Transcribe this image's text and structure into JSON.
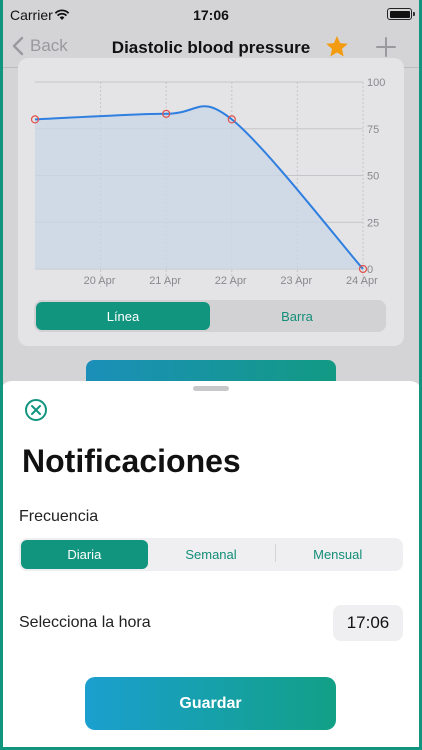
{
  "status_bar": {
    "carrier": "Carrier",
    "time": "17:06"
  },
  "nav": {
    "back_label": "Back",
    "title": "Diastolic blood pressure"
  },
  "chart_data": {
    "type": "line",
    "x": [
      "19 Apr",
      "21 Apr",
      "22 Apr",
      "24 Apr"
    ],
    "points": [
      {
        "x": 19.0,
        "y": 80
      },
      {
        "x": 21.0,
        "y": 83
      },
      {
        "x": 22.0,
        "y": 80
      },
      {
        "x": 24.0,
        "y": 0
      }
    ],
    "xticks": [
      "20 Apr",
      "21 Apr",
      "22 Apr",
      "23 Apr",
      "24 Apr"
    ],
    "xtick_values": [
      20,
      21,
      22,
      23,
      24
    ],
    "yticks": [
      "100",
      "75",
      "50",
      "25",
      "0"
    ],
    "ytick_values": [
      100,
      75,
      50,
      25,
      0
    ],
    "xlim": [
      19,
      24
    ],
    "ylim": [
      0,
      100
    ],
    "grid": true,
    "line_color": "#2f7fe0",
    "marker_color": "#e0504a",
    "fill_color": "#c9d6e6"
  },
  "chart_toggle": {
    "options": [
      "Línea",
      "Barra"
    ],
    "selected": "Línea"
  },
  "sheet": {
    "title": "Notificaciones",
    "frequency_label": "Frecuencia",
    "frequency_options": [
      "Diaria",
      "Semanal",
      "Mensual"
    ],
    "frequency_selected": "Diaria",
    "time_label": "Selecciona la hora",
    "time_value": "17:06",
    "save_label": "Guardar"
  },
  "colors": {
    "accent": "#12957f",
    "star": "#f39c12"
  }
}
